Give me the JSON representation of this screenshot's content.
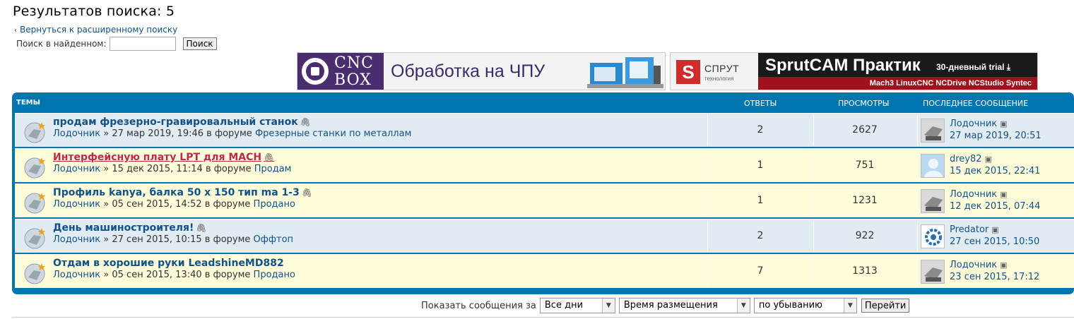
{
  "page": {
    "title": "Результатов поиска: 5",
    "back_link": "Вернуться к расширенному поиску",
    "search_within_label": "Поиск в найденном:",
    "search_within_value": "",
    "search_button": "Поиск"
  },
  "banners": {
    "cnc": {
      "logo_line1": "CNC",
      "logo_line2": "BOX",
      "text": "Обработка на ЧПУ"
    },
    "sprut": {
      "brand": "СПРУТ",
      "brand_sub": "технология",
      "title": "SprutCAM Практик",
      "trial": "30-дневный trial ⤓",
      "bar": "Mach3 LinuxCNC NCDrive NCStudio Syntec"
    }
  },
  "table": {
    "headers": {
      "topics": "ТЕМЫ",
      "replies": "ОТВЕТЫ",
      "views": "ПРОСМОТРЫ",
      "last_post": "ПОСЛЕДНЕЕ СООБЩЕНИЕ"
    },
    "rows": [
      {
        "title": "продам фрезерно-гравировальный станок",
        "author": "Лодочник",
        "date": "27 мар 2019, 19:46",
        "in_forum": "в форуме",
        "forum": "Фрезерные станки по металлам",
        "replies": "2",
        "views": "2627",
        "last_author": "Лодочник",
        "last_time": "27 мар 2019, 20:51"
      },
      {
        "title": "Интерфейсную плату LPT для MACH",
        "author": "Лодочник",
        "date": "15 дек 2015, 11:14",
        "in_forum": "в форуме",
        "forum": "Продам",
        "replies": "1",
        "views": "751",
        "last_author": "drey82",
        "last_time": "15 дек 2015, 22:41"
      },
      {
        "title": "Профиль kanya, балка 50 х 150 тип ma 1-3",
        "author": "Лодочник",
        "date": "05 сен 2015, 14:52",
        "in_forum": "в форуме",
        "forum": "Продано",
        "replies": "1",
        "views": "1231",
        "last_author": "Лодочник",
        "last_time": "12 дек 2015, 07:44"
      },
      {
        "title": "День машиностроителя!",
        "author": "Лодочник",
        "date": "27 сен 2015, 10:15",
        "in_forum": "в форуме",
        "forum": "Оффтоп",
        "replies": "2",
        "views": "922",
        "last_author": "Predator",
        "last_time": "27 сен 2015, 10:50"
      },
      {
        "title": "Отдам в хорошие руки LeadshineMD882",
        "author": "Лодочник",
        "date": "05 сен 2015, 13:40",
        "in_forum": "в форуме",
        "forum": "Продано",
        "replies": "7",
        "views": "1313",
        "last_author": "Лодочник",
        "last_time": "23 сен 2015, 17:12"
      }
    ]
  },
  "sort": {
    "label": "Показать сообщения за",
    "days": "Все дни",
    "sort_by": "Время размещения",
    "direction": "по убыванию",
    "go": "Перейти"
  },
  "colors": {
    "header_blue": "#0076b1",
    "row_blue": "#e1ebf2",
    "row_yellow": "#fffcd9",
    "link": "#105289",
    "hot_link": "#bc2a4d"
  }
}
